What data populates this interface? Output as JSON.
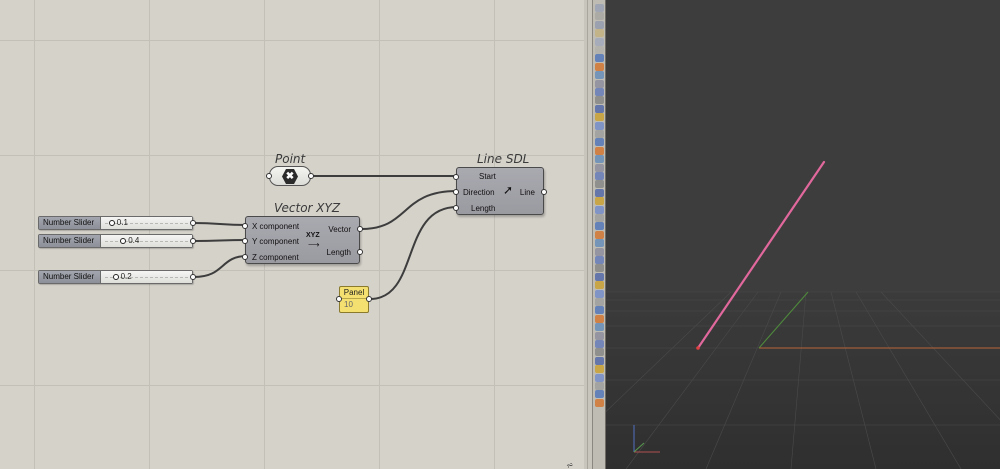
{
  "components": {
    "point": {
      "title": "Point",
      "icon": "point-param-icon"
    },
    "vector_xyz": {
      "title": "Vector XYZ",
      "inputs": [
        "X component",
        "Y component",
        "Z component"
      ],
      "outputs": [
        "Vector",
        "Length"
      ],
      "icon_text": "XYZ"
    },
    "line_sdl": {
      "title": "Line SDL",
      "inputs": [
        "Start",
        "Direction",
        "Length"
      ],
      "outputs": [
        "Line"
      ]
    },
    "panel": {
      "label": "Panel",
      "value": "10"
    }
  },
  "sliders": [
    {
      "name": "Number Slider",
      "value": "0.1",
      "fraction": 0.1
    },
    {
      "name": "Number Slider",
      "value": "0.4",
      "fraction": 0.4
    },
    {
      "name": "Number Slider",
      "value": "0.2",
      "fraction": 0.2
    }
  ],
  "colors": {
    "line_preview": "#e0689c",
    "grid_x_axis": "#b8643a",
    "grid_y_axis": "#4f8a3c",
    "panel_fill": "#f3e070",
    "viewport_bg": "#3a3a3a"
  },
  "toolbar": {
    "icons": [
      "tool-icon"
    ]
  }
}
